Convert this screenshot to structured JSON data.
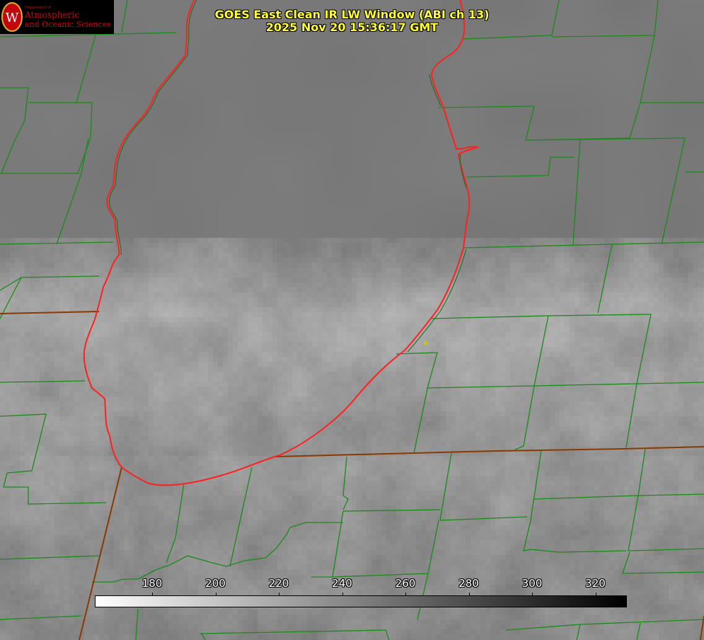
{
  "title_line1": "GOES East Clean IR LW Window (ABI ch 13)",
  "title_line2": "2025 Nov 20 15:36:17 GMT",
  "logo": {
    "department": "Department of",
    "line1": "Atmospheric",
    "line2": "and Oceanic Sciences",
    "letter": "W"
  },
  "colorbar": {
    "ticks": [
      "180",
      "200",
      "220",
      "240",
      "260",
      "280",
      "300",
      "320"
    ]
  },
  "colors": {
    "county_lines": "#1a8a1a",
    "state_lines": "#8a3a00",
    "coastline": "#ff2020",
    "title": "#ffff33",
    "marker": "#d4c400"
  }
}
